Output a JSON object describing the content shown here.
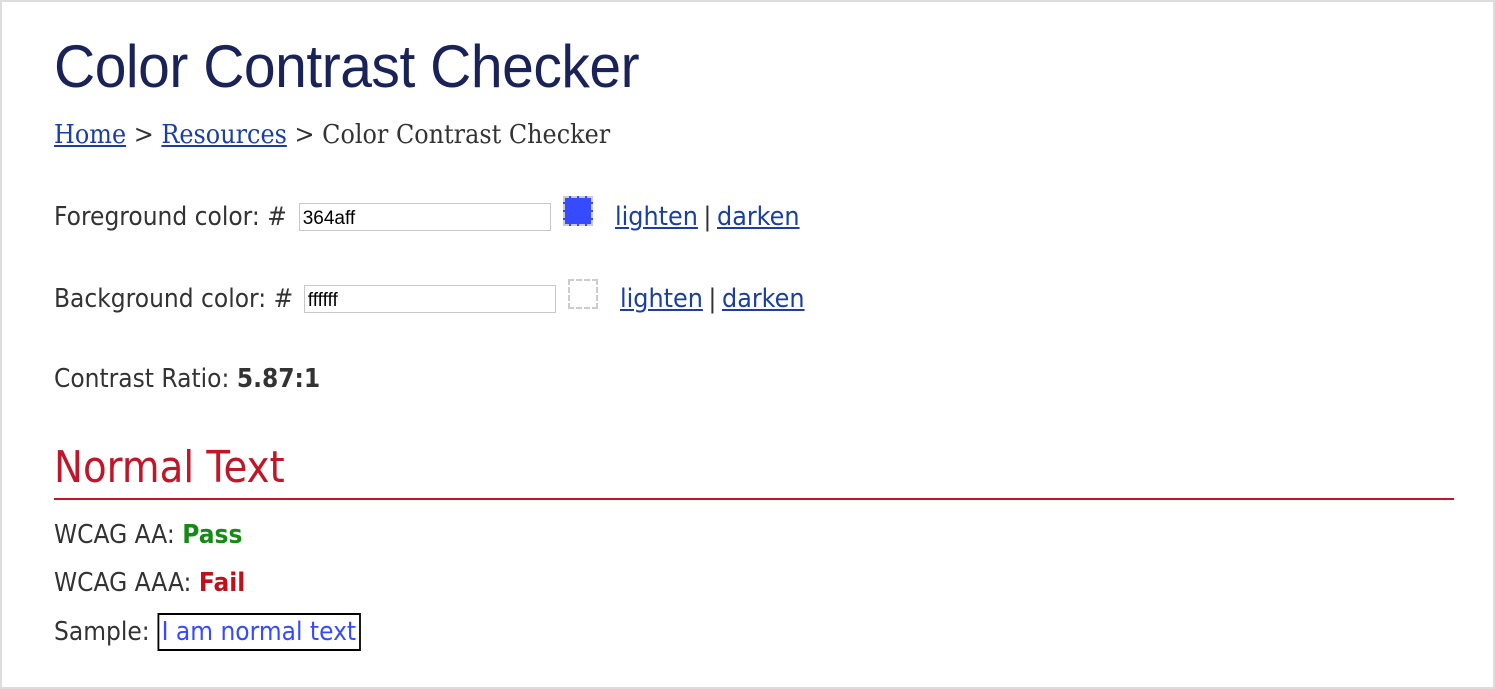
{
  "page": {
    "title": "Color Contrast Checker"
  },
  "breadcrumb": {
    "items": [
      {
        "label": "Home",
        "link": true
      },
      {
        "label": "Resources",
        "link": true
      },
      {
        "label": "Color Contrast Checker",
        "link": false
      }
    ],
    "separator": ">"
  },
  "foreground": {
    "label": "Foreground color: #",
    "value": "364aff",
    "swatch_color": "#364aff",
    "lighten_label": "lighten",
    "darken_label": "darken",
    "separator": "|"
  },
  "background": {
    "label": "Background color: #",
    "value": "ffffff",
    "swatch_color": "#ffffff",
    "lighten_label": "lighten",
    "darken_label": "darken",
    "separator": "|"
  },
  "contrast": {
    "label": "Contrast Ratio: ",
    "value": "5.87:1"
  },
  "normal_text": {
    "heading": "Normal Text",
    "aa_label": "WCAG AA: ",
    "aa_result": "Pass",
    "aaa_label": "WCAG AAA: ",
    "aaa_result": "Fail",
    "sample_label": "Sample: ",
    "sample_text": "I am normal text"
  },
  "colors": {
    "title": "#1a2357",
    "heading": "#c0162a",
    "pass": "#168a16",
    "fail": "#c0101a",
    "link": "#1a3fa0"
  }
}
